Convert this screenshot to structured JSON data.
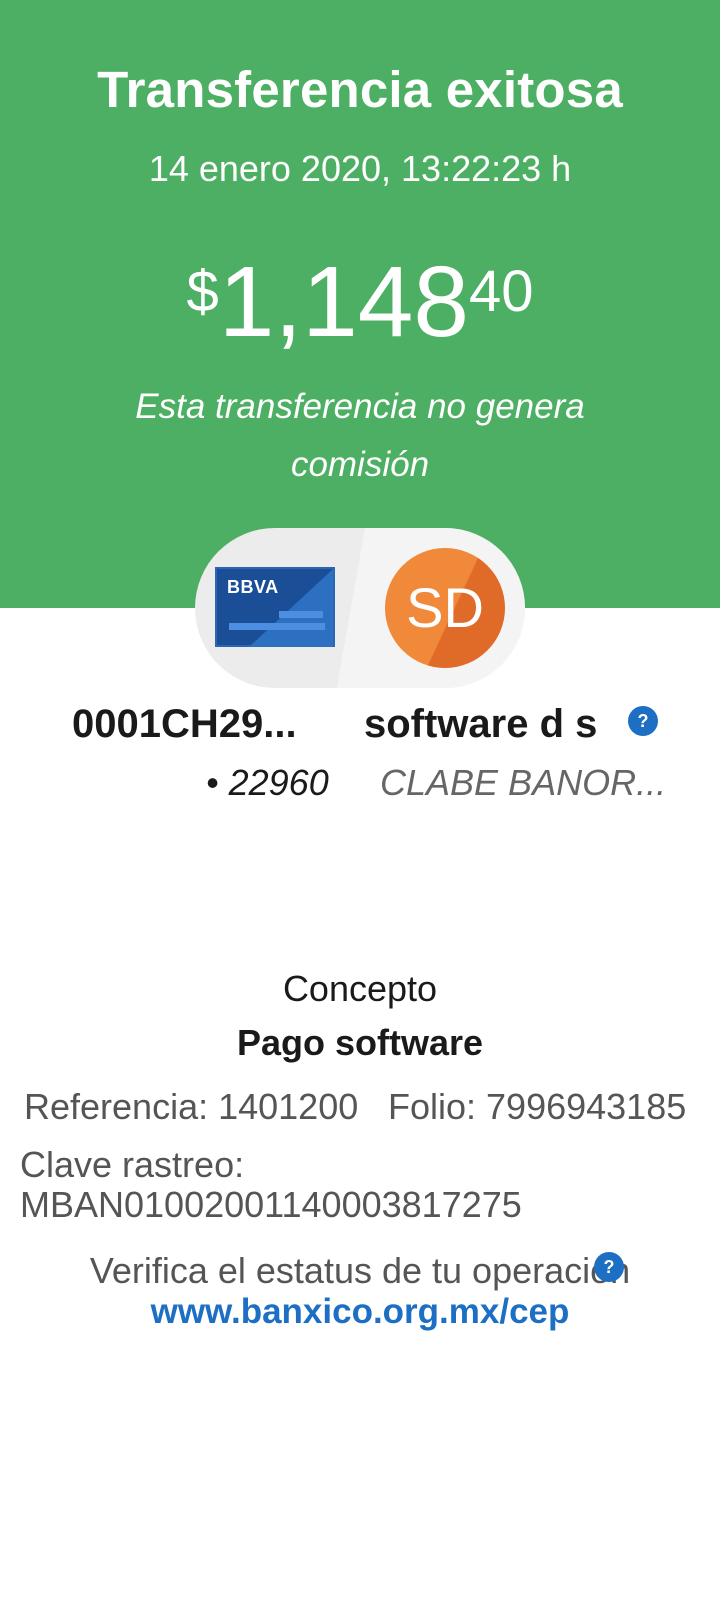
{
  "header": {
    "title": "Transferencia exitosa",
    "datetime": "14 enero 2020, 13:22:23 h",
    "amount_currency": "$",
    "amount_integer": "1,148",
    "amount_decimals": "40",
    "note": "Esta transferencia no genera comisión"
  },
  "transfer": {
    "bank_logo_text": "BBVA",
    "recipient_initials": "SD",
    "origin_account": "0001CH29...",
    "origin_account_suffix": "• 22960",
    "recipient_name": "software d s",
    "recipient_account": "CLABE BANOR...",
    "help_icon_glyph": "?"
  },
  "details": {
    "concepto_label": "Concepto",
    "concepto_value": "Pago software",
    "referencia": "Referencia: 1401200",
    "folio": "Folio: 7996943185",
    "clave_label": "Clave rastreo:",
    "clave_value": "MBAN01002001140003817275",
    "verify_text": "Verifica el estatus de tu operación",
    "cep_link": "www.banxico.org.mx/cep"
  },
  "colors": {
    "success_green": "#4caf63",
    "link_blue": "#1d6fc4",
    "avatar_orange": "#f08a3a",
    "bank_blue": "#1a4e96"
  }
}
